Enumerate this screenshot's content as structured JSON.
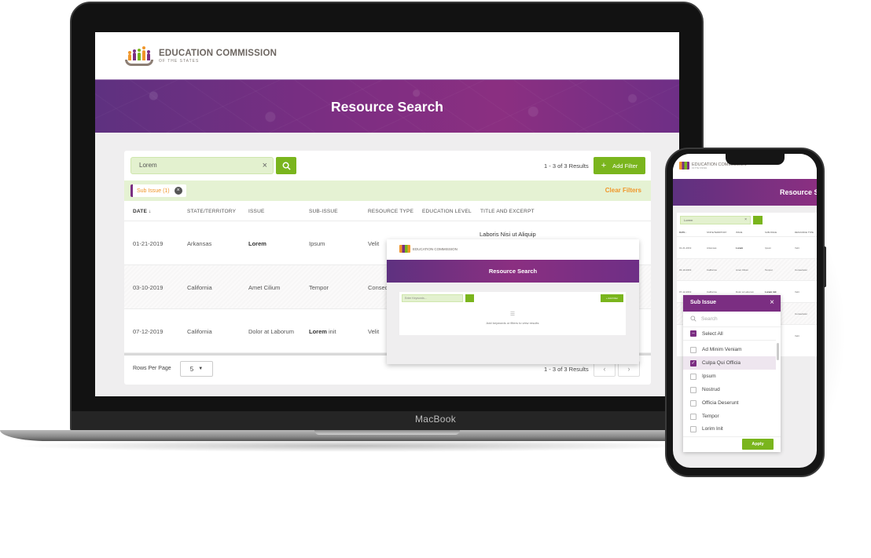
{
  "brand": {
    "name": "EDUCATION COMMISSION",
    "subtitle": "OF THE STATES",
    "colors": {
      "purple": "#7b2e82",
      "green": "#7ab51d",
      "orange": "#f0962a"
    }
  },
  "laptop": {
    "device_label": "MacBook",
    "page_title": "Resource Search",
    "search": {
      "value": "Lorem",
      "clear_icon": "×"
    },
    "results_count": "1 - 3 of 3 Results",
    "add_filter_label": "Add Filter",
    "add_filter_icon": "+",
    "active_filter": "Sub Issue (1)",
    "clear_filters_label": "Clear Filters",
    "columns": [
      "DATE ↓",
      "STATE/TERRITORY",
      "ISSUE",
      "SUB-ISSUE",
      "RESOURCE TYPE",
      "EDUCATION LEVEL",
      "TITLE AND EXCERPT"
    ],
    "rows": [
      {
        "date": "01-21-2019",
        "state": "Arkansas",
        "issue": "Lorem",
        "issue_bold": true,
        "sub_issue_bold": "",
        "sub_issue": "Ipsum",
        "resource_type": "Velit",
        "title": "Laboris Nisi ut Aliquip"
      },
      {
        "date": "03-10-2019",
        "state": "California",
        "issue": "Amet Cilium",
        "issue_bold": false,
        "sub_issue_bold": "",
        "sub_issue": "Tempor",
        "resource_type": "Conseq",
        "title": ""
      },
      {
        "date": "07-12-2019",
        "state": "California",
        "issue": "Dolor at Laborum",
        "issue_bold": false,
        "sub_issue_bold": "Lorem",
        "sub_issue": " init",
        "resource_type": "Velit",
        "title": ""
      }
    ],
    "rows_per_page_label": "Rows Per Page",
    "rows_per_page_value": "5",
    "footer_count": "1 - 3 of 3 Results",
    "prev_icon": "‹",
    "next_icon": "›"
  },
  "preview": {
    "page_title": "Resource Search",
    "search_placeholder": "Enter Keywords...",
    "add_filter_label": "+ Add Filter",
    "list_icon": "☰",
    "empty_message": "Add keywords or filters to view results"
  },
  "phone": {
    "page_title": "Resource Se",
    "search": {
      "value": "Lorem",
      "clear_icon": "×"
    },
    "columns": [
      "DATE ↓",
      "STATE/TERRITORY",
      "ISSUE",
      "SUB-ISSUE",
      "RESOURCE TYPE"
    ],
    "rows": [
      {
        "date": "01-21-2019",
        "state": "Arkansas",
        "issue": "Lorem",
        "sub_issue": "Ipsum",
        "resource_type": "Velit"
      },
      {
        "date": "03-10-2019",
        "state": "California",
        "issue": "Amet Cilium",
        "sub_issue": "Tempor",
        "resource_type": "Consectetur"
      },
      {
        "date": "07-12-2019",
        "state": "California",
        "issue": "Dolor at Laborum",
        "sub_issue": "Lorem init",
        "resource_type": "Velit"
      },
      {
        "date": "",
        "state": "",
        "issue": "",
        "sub_issue": "",
        "resource_type": "Consectetur"
      },
      {
        "date": "",
        "state": "",
        "issue": "",
        "sub_issue": "",
        "resource_type": "Velit"
      }
    ],
    "sub_issue_panel": {
      "title": "Sub Issue",
      "close_icon": "×",
      "search_placeholder": "Search",
      "select_all_label": "Select All",
      "select_all_state": "partial",
      "options": [
        {
          "label": "Ad Minim Veniam",
          "checked": false
        },
        {
          "label": "Culpa Qui Officia",
          "checked": true
        },
        {
          "label": "Ipsum",
          "checked": false
        },
        {
          "label": "Nostrud",
          "checked": false
        },
        {
          "label": "Officia Deserunt",
          "checked": false
        },
        {
          "label": "Tempor",
          "checked": false
        },
        {
          "label": "Lorim Init",
          "checked": false
        }
      ],
      "apply_label": "Apply"
    }
  }
}
